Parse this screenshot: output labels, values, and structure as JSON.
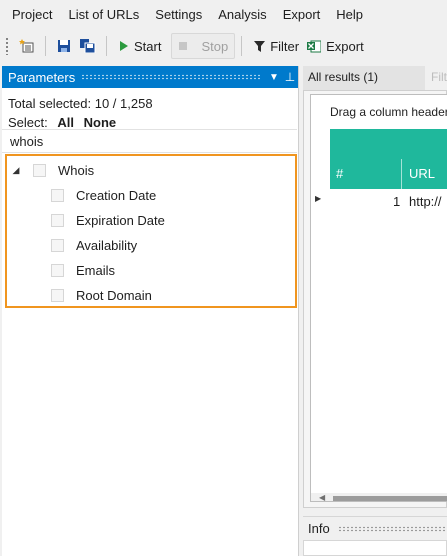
{
  "menu": [
    "Project",
    "List of URLs",
    "Settings",
    "Analysis",
    "Export",
    "Help"
  ],
  "toolbar": {
    "start_label": "Start",
    "stop_label": "Stop",
    "filter_label": "Filter",
    "export_label": "Export",
    "icons": [
      "new-list-icon",
      "save-icon",
      "save-all-icon",
      "play-icon",
      "stop-icon",
      "filter-icon",
      "excel-export-icon"
    ]
  },
  "parameters_panel": {
    "title": "Parameters",
    "total_selected": "Total selected: 10 / 1,258",
    "select_label": "Select:",
    "select_all": "All",
    "select_none": "None",
    "search_value": "whois",
    "tree": {
      "group": "Whois",
      "children": [
        "Creation Date",
        "Expiration Date",
        "Availability",
        "Emails",
        "Root Domain"
      ]
    }
  },
  "results": {
    "tab_active": "All results (1)",
    "tab_other": "Filt",
    "drag_hint": "Drag a column header",
    "columns": [
      "#",
      "URL"
    ],
    "rows": [
      {
        "num": "1",
        "url": "http://"
      }
    ]
  },
  "info": {
    "title": "Info"
  },
  "colors": {
    "accent_blue": "#007acc",
    "teal": "#1fb89c",
    "highlight_orange": "#f0951f"
  }
}
